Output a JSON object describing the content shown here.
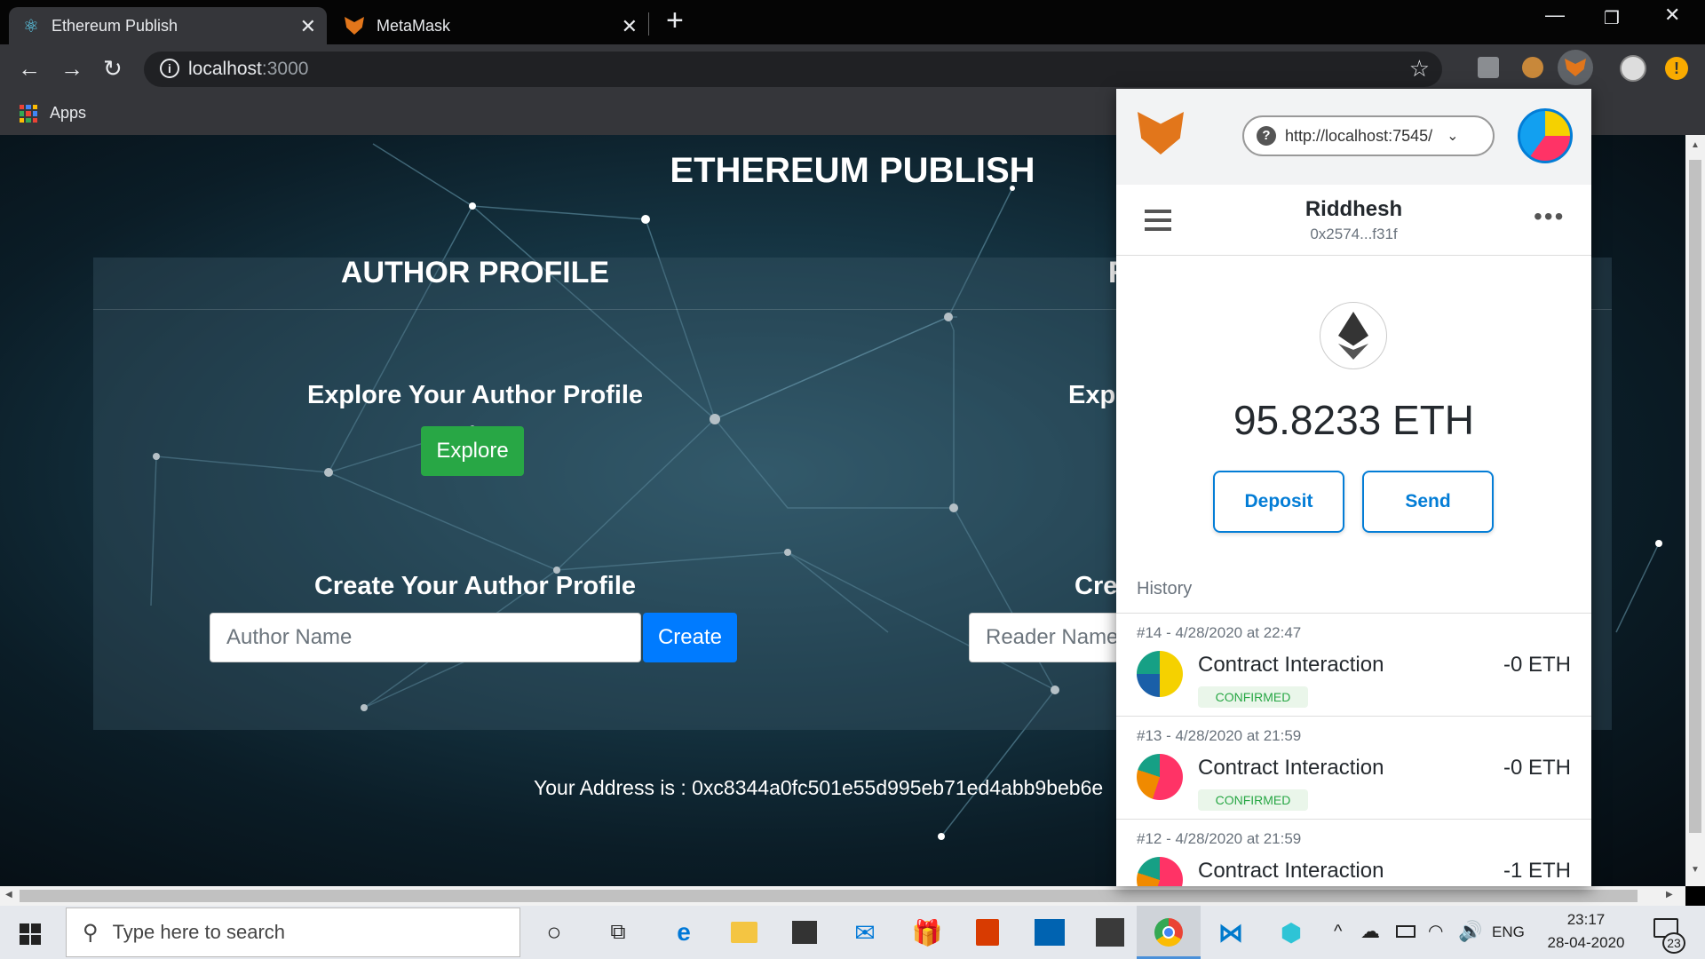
{
  "browser": {
    "tabs": [
      {
        "title": "Ethereum Publish",
        "icon": "react-icon"
      },
      {
        "title": "MetaMask",
        "icon": "metamask-fox-icon"
      }
    ],
    "new_tab": "+",
    "url_host": "localhost",
    "url_port": ":3000",
    "bookmarks_apps": "Apps"
  },
  "page": {
    "title": "ETHEREUM PUBLISH",
    "author_profile": {
      "heading": "AUTHOR PROFILE",
      "explore_heading": "Explore Your Author Profile",
      "explore_button": "Explore",
      "create_heading": "Create Your Author Profile",
      "name_placeholder": "Author Name",
      "create_button": "Create"
    },
    "reader_profile": {
      "heading_partial": "R",
      "explore_heading_partial": "Expl",
      "create_heading_partial": "Cre",
      "name_placeholder": "Reader Name"
    },
    "address_label": "Your Address is : 0xc8344a0fc501e55d995eb71ed4abb9beb6e"
  },
  "metamask": {
    "network": "http://localhost:7545/",
    "account_name": "Riddhesh",
    "account_address": "0x2574...f31f",
    "balance": "95.8233",
    "currency": "ETH",
    "deposit_button": "Deposit",
    "send_button": "Send",
    "history_label": "History",
    "history": [
      {
        "date": "#14 - 4/28/2020 at 22:47",
        "title": "Contract Interaction",
        "status": "CONFIRMED",
        "amount": "-0 ETH"
      },
      {
        "date": "#13 - 4/28/2020 at 21:59",
        "title": "Contract Interaction",
        "status": "CONFIRMED",
        "amount": "-0 ETH"
      },
      {
        "date": "#12 - 4/28/2020 at 21:59",
        "title": "Contract Interaction",
        "status": "",
        "amount": "-1 ETH"
      }
    ]
  },
  "taskbar": {
    "search_placeholder": "Type here to search",
    "language": "ENG",
    "time": "23:17",
    "date": "28-04-2020",
    "notifications": "23"
  },
  "colors": {
    "explore_green": "#28a745",
    "create_blue": "#007bff",
    "metamask_blue": "#037dd6",
    "confirmed_green": "#28a745"
  }
}
